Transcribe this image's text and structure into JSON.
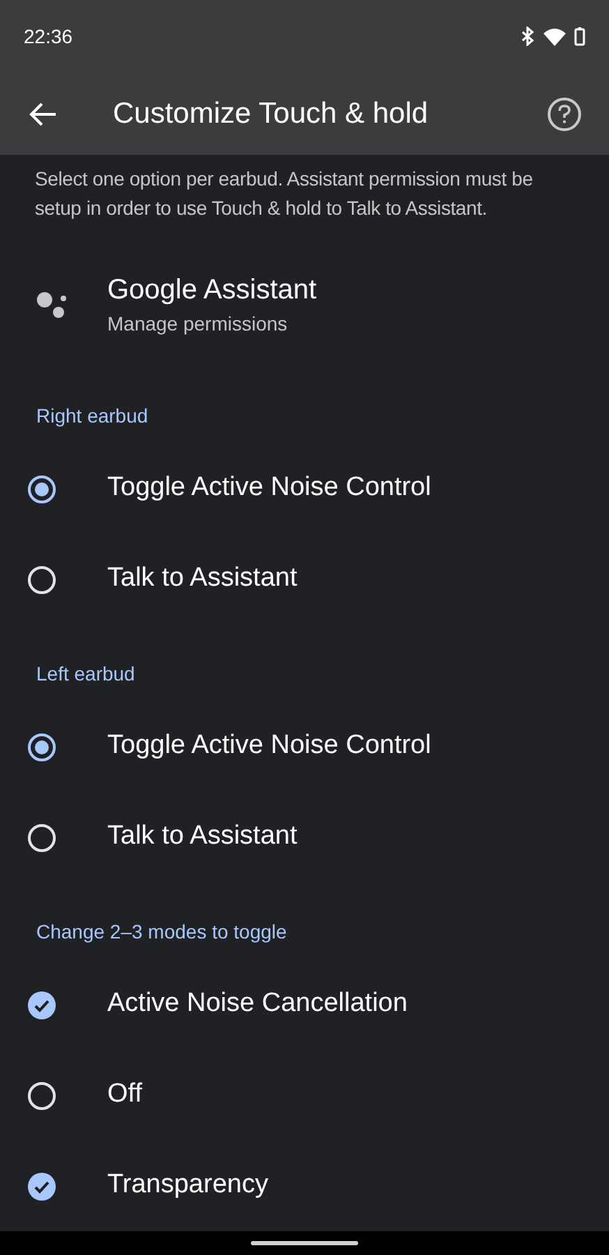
{
  "status_bar": {
    "time": "22:36"
  },
  "app_bar": {
    "title": "Customize Touch & hold"
  },
  "description": "Select one option per earbud. Assistant permission must be setup in order to use Touch & hold to Talk to Assistant.",
  "assistant": {
    "title": "Google Assistant",
    "subtitle": "Manage permissions"
  },
  "sections": [
    {
      "label": "Right earbud",
      "kind": "radio",
      "options": [
        {
          "label": "Toggle Active Noise Control",
          "selected": true
        },
        {
          "label": "Talk to Assistant",
          "selected": false
        }
      ]
    },
    {
      "label": "Left earbud",
      "kind": "radio",
      "options": [
        {
          "label": "Toggle Active Noise Control",
          "selected": true
        },
        {
          "label": "Talk to Assistant",
          "selected": false
        }
      ]
    },
    {
      "label": "Change 2–3 modes to toggle",
      "kind": "checkbox",
      "options": [
        {
          "label": "Active Noise Cancellation",
          "checked": true
        },
        {
          "label": "Off",
          "checked": false
        },
        {
          "label": "Transparency",
          "checked": true
        }
      ]
    }
  ]
}
